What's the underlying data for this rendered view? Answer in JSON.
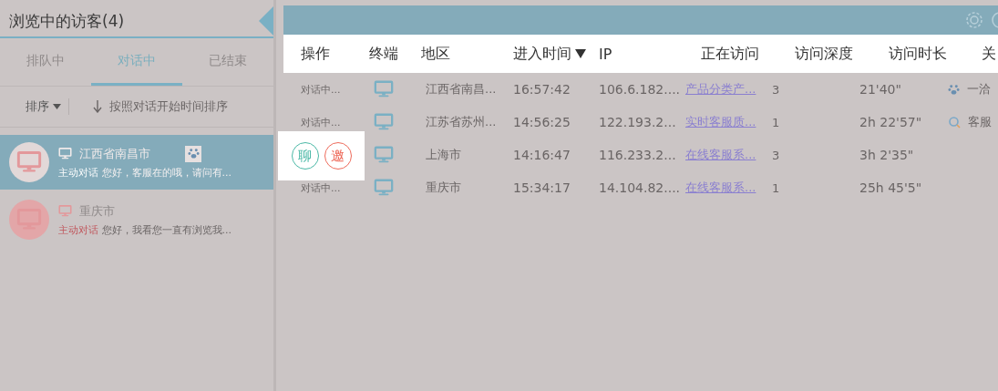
{
  "sidebar": {
    "title": "浏览中的访客(4)",
    "tabs": [
      {
        "label": "排队中",
        "selected": false
      },
      {
        "label": "对话中",
        "selected": true
      },
      {
        "label": "已结束",
        "selected": false
      }
    ],
    "sort": {
      "label": "排序",
      "hint": "按照对话开始时间排序"
    },
    "visitors": [
      {
        "region": "江西省南昌市",
        "tag": "主动对话",
        "message": "您好，客服在的哦，请问有...",
        "selected": true,
        "badge": {
          "kind": "paw"
        }
      },
      {
        "region": "重庆市",
        "tag": "主动对话",
        "message": "您好，我看您一直有浏览我...",
        "selected": false
      }
    ]
  },
  "table": {
    "columns": [
      {
        "label": "操作",
        "sorted": false
      },
      {
        "label": "终端",
        "sorted": false
      },
      {
        "label": "地区",
        "sorted": false
      },
      {
        "label": "进入时间",
        "sorted": true
      },
      {
        "label": "IP",
        "sorted": false
      },
      {
        "label": "正在访问",
        "sorted": false
      },
      {
        "label": "访问深度",
        "sorted": false
      },
      {
        "label": "访问时长",
        "sorted": false
      },
      {
        "label": "关",
        "sorted": false
      }
    ],
    "rows": [
      {
        "status": "对话中...",
        "region": "江西省南昌...",
        "time": "16:57:42",
        "ip": "106.6.182....",
        "page": "产品分类产...",
        "depth": "3",
        "duration": "21'40\"",
        "keyword": {
          "kind": "paw",
          "text": "一洽"
        }
      },
      {
        "status": "对话中...",
        "region": "江苏省苏州...",
        "time": "14:56:25",
        "ip": "122.193.2...",
        "page": "实时客服质...",
        "depth": "1",
        "duration": "2h 22'57\"",
        "keyword": {
          "kind": "search",
          "text": "客服"
        }
      },
      {
        "region": "上海市",
        "time": "14:16:47",
        "ip": "116.233.2...",
        "page": "在线客服系...",
        "depth": "3",
        "duration": "3h 2'35\"",
        "actions": [
          "聊",
          "邀"
        ]
      },
      {
        "status": "对话中...",
        "region": "重庆市",
        "time": "15:34:17",
        "ip": "14.104.82....",
        "page": "在线客服系...",
        "depth": "1",
        "duration": "25h 45'5\""
      }
    ]
  }
}
